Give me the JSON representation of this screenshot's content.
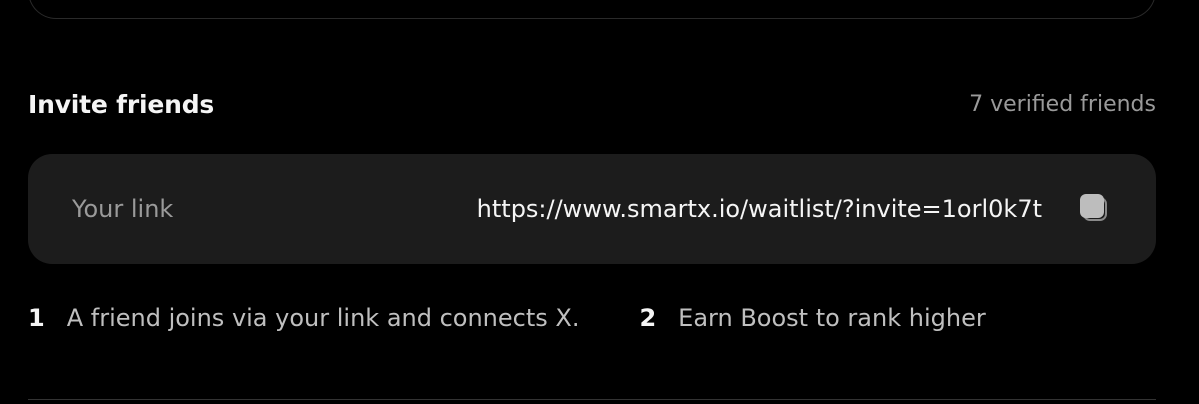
{
  "invite": {
    "title": "Invite friends",
    "verified_count": "7 verified friends",
    "link_label": "Your link",
    "link_url": "https://www.smartx.io/waitlist/?invite=1orl0k7t",
    "copy_icon": "copy-icon"
  },
  "steps": [
    {
      "number": "1",
      "text": "A friend joins via your link and connects X."
    },
    {
      "number": "2",
      "text": "Earn Boost to rank higher"
    }
  ],
  "colors": {
    "background": "#000000",
    "card": "#1c1c1c",
    "text_primary": "#f5f5f5",
    "text_secondary": "#9a9a9a"
  }
}
